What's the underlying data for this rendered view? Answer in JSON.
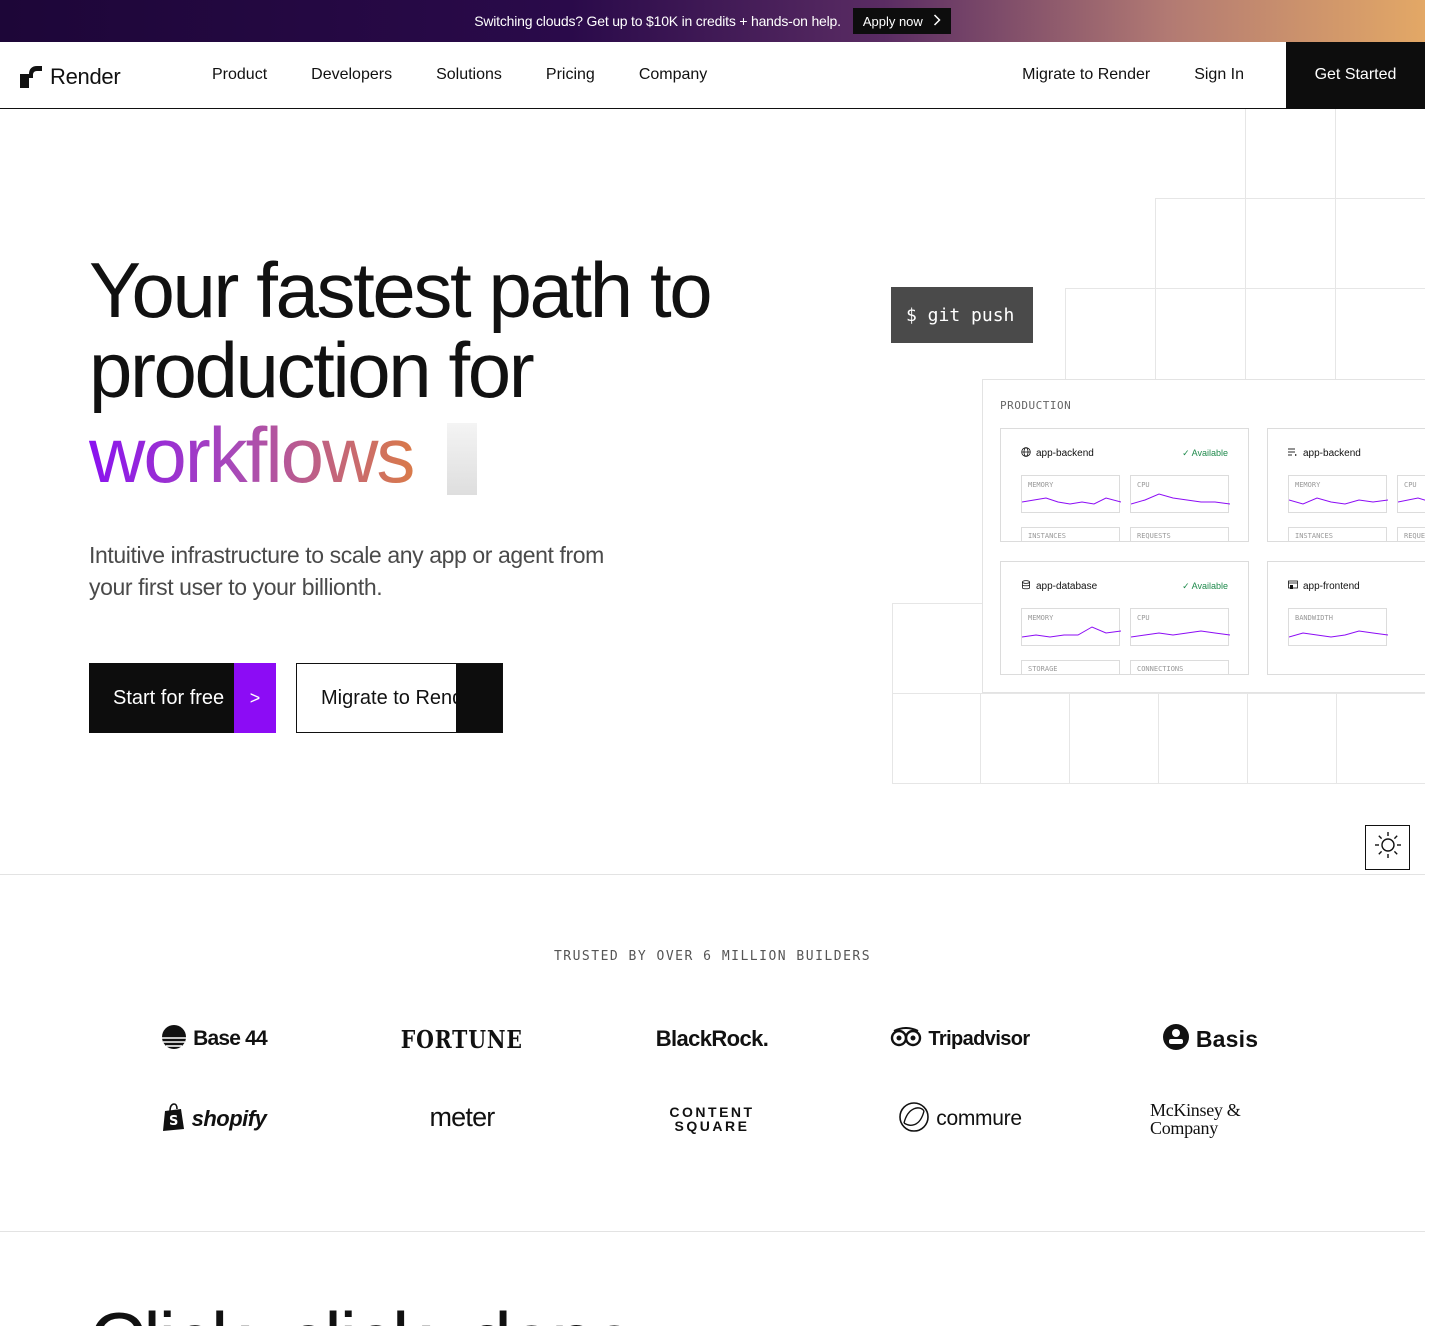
{
  "banner": {
    "text": "Switching clouds? Get up to $10K in credits + hands-on help.",
    "cta": "Apply now",
    "cta_icon": "chevron-right-icon"
  },
  "header": {
    "logo_text": "Render",
    "nav": [
      "Product",
      "Developers",
      "Solutions",
      "Pricing",
      "Company"
    ],
    "migrate": "Migrate to Render",
    "sign_in": "Sign In",
    "get_started": "Get Started"
  },
  "hero": {
    "title_line1": "Your fastest path to",
    "title_line2": "production for",
    "rotating_word": "workflows",
    "subtitle": "Intuitive infrastructure to scale any app or agent from your first user to your billionth.",
    "primary_cta": "Start for free",
    "primary_cta_icon": ">",
    "secondary_cta": "Migrate to Render"
  },
  "illustration": {
    "command": "$ git push",
    "env_label": "PRODUCTION",
    "services": [
      {
        "name": "app-backend",
        "icon": "globe-icon",
        "status": "Available",
        "metrics": [
          "MEMORY",
          "CPU"
        ],
        "bottom": [
          "INSTANCES",
          "REQUESTS"
        ]
      },
      {
        "name": "app-backend",
        "icon": "worker-icon",
        "status": "",
        "metrics": [
          "MEMORY",
          "CPU"
        ],
        "bottom": [
          "INSTANCES",
          "REQUE"
        ]
      },
      {
        "name": "app-database",
        "icon": "database-icon",
        "status": "Available",
        "metrics": [
          "MEMORY",
          "CPU"
        ],
        "bottom": [
          "STORAGE",
          "CONNECTIONS"
        ]
      },
      {
        "name": "app-frontend",
        "icon": "static-site-icon",
        "status": "",
        "metrics": [
          "BANDWIDTH"
        ],
        "bottom": []
      }
    ],
    "accent": "#8c0cf5",
    "status_color": "#1f8a4c"
  },
  "trusted": {
    "label": "TRUSTED BY OVER 6 MILLION BUILDERS",
    "logos": [
      "Base 44",
      "FORTUNE",
      "BlackRock.",
      "Tripadvisor",
      "Basis",
      "shopify",
      "meter",
      "CONTENT SQUARE",
      "commure",
      "McKinsey & Company"
    ]
  },
  "next_section": {
    "heading": "Click, click, done."
  }
}
